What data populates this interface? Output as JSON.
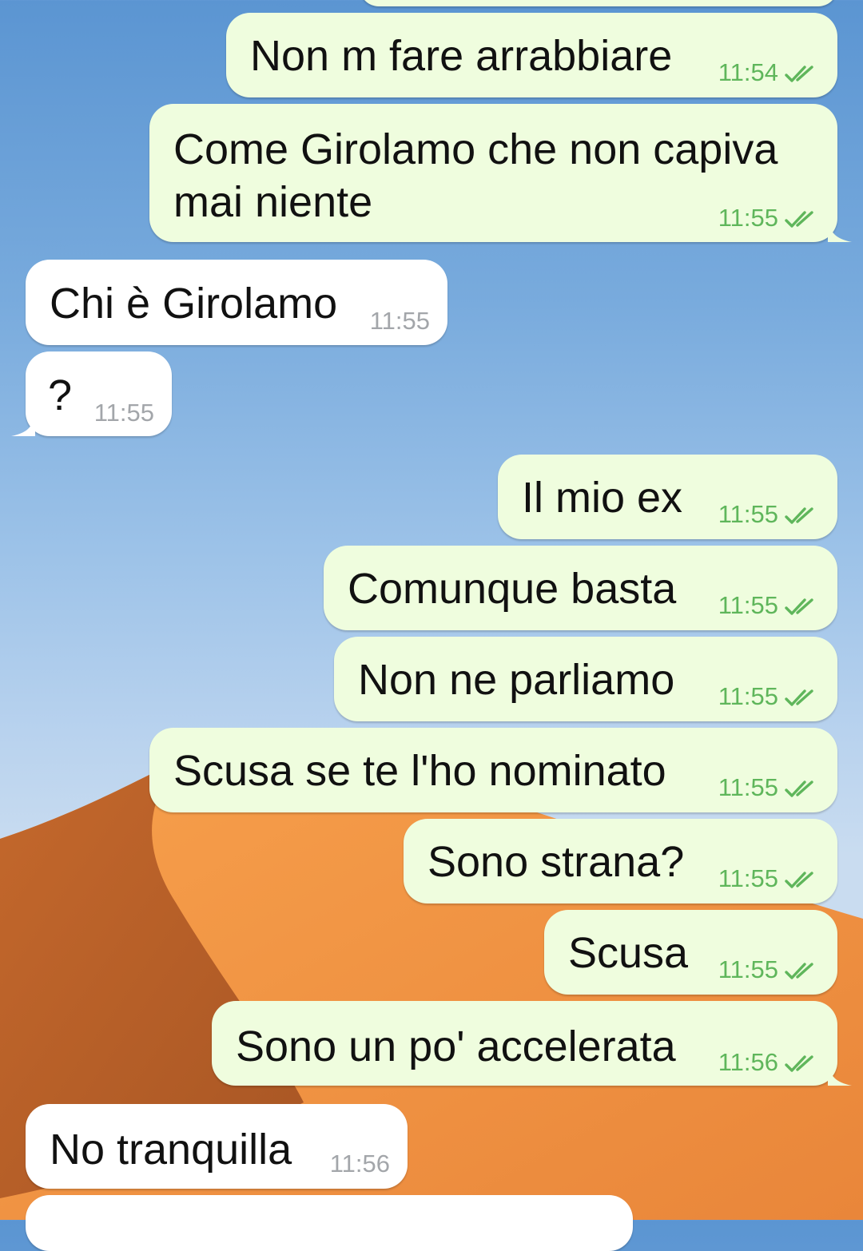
{
  "messages": [
    {
      "id": "m1",
      "direction": "outgoing",
      "text": "Non m fare arrabbiare",
      "time": "11:54",
      "read": true
    },
    {
      "id": "m2",
      "direction": "outgoing",
      "text_lines": [
        "Come Girolamo che non capiva",
        "mai niente"
      ],
      "time": "11:55",
      "read": true
    },
    {
      "id": "m3",
      "direction": "incoming",
      "text": "Chi è Girolamo",
      "time": "11:55"
    },
    {
      "id": "m4",
      "direction": "incoming",
      "text": "?",
      "time": "11:55"
    },
    {
      "id": "m5",
      "direction": "outgoing",
      "text": "Il mio ex",
      "time": "11:55",
      "read": true
    },
    {
      "id": "m6",
      "direction": "outgoing",
      "text": "Comunque basta",
      "time": "11:55",
      "read": true
    },
    {
      "id": "m7",
      "direction": "outgoing",
      "text": "Non ne parliamo",
      "time": "11:55",
      "read": true
    },
    {
      "id": "m8",
      "direction": "outgoing",
      "text": "Scusa se te l'ho nominato",
      "time": "11:55",
      "read": true
    },
    {
      "id": "m9",
      "direction": "outgoing",
      "text": "Sono strana?",
      "time": "11:55",
      "read": true
    },
    {
      "id": "m10",
      "direction": "outgoing",
      "text": "Scusa",
      "time": "11:55",
      "read": true
    },
    {
      "id": "m11",
      "direction": "outgoing",
      "text": "Sono un po' accelerata",
      "time": "11:56",
      "read": true
    },
    {
      "id": "m12",
      "direction": "incoming",
      "text": "No tranquilla",
      "time": "11:56"
    }
  ],
  "colors": {
    "outgoing_bubble": "#effdde",
    "incoming_bubble": "#ffffff",
    "outgoing_time": "#5fb65b",
    "incoming_time": "#a3a6aa",
    "read_check": "#5fb65b"
  },
  "icons": {
    "read_receipt": "double-check-icon"
  },
  "wallpaper": "desert-dune-sky"
}
